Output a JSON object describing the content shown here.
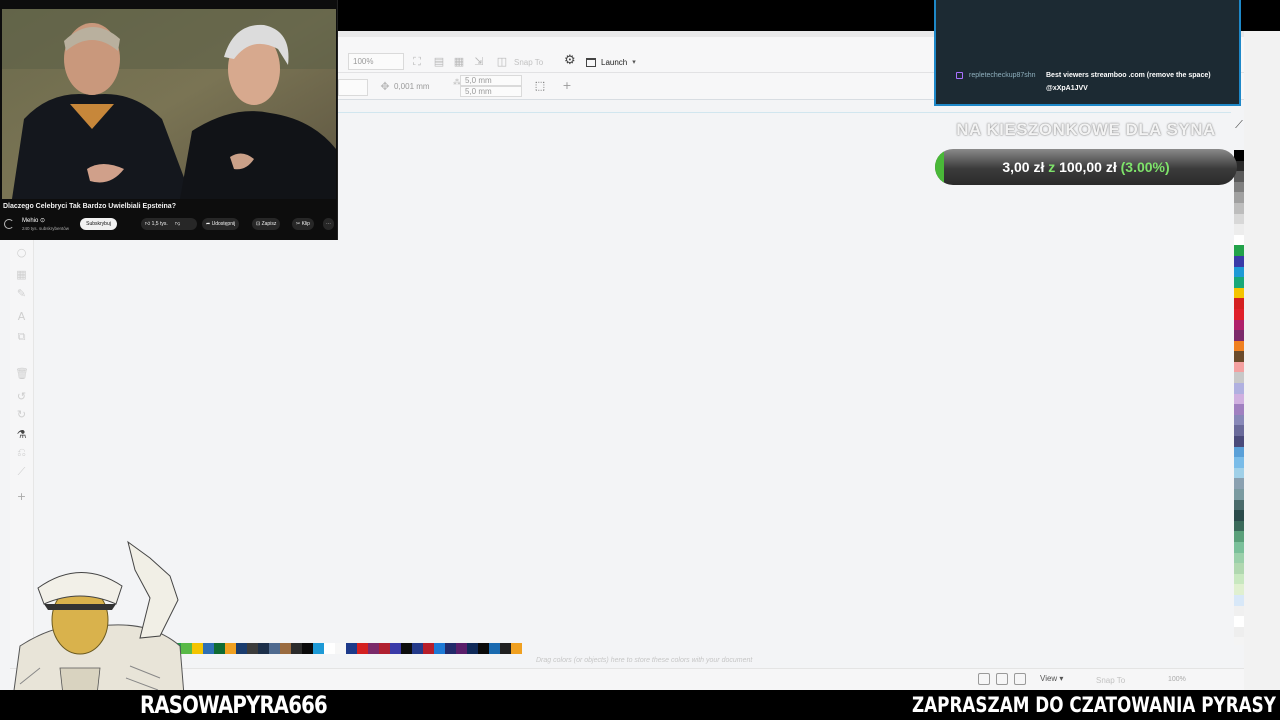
{
  "app": {
    "zoom_field": "100%",
    "nudge_value": "0,001 mm",
    "dup_x": "5,0 mm",
    "dup_y": "5,0 mm",
    "snap_to": "Snap To",
    "launch_label": "Launch",
    "palette_hint": "Drag colors (or objects) here to store these colors with your document",
    "status_view": "View",
    "status_snap": "Snap To",
    "status_zoom": "100%",
    "accent": "#1e88c8",
    "document_palette": [
      "#22a24a",
      "#58b947",
      "#f4c400",
      "#2e6fb5",
      "#0f6b33",
      "#f0a020",
      "#1a3c6e",
      "#3c3c3c",
      "#1c2f4a",
      "#4f6a8f",
      "#9a6b40",
      "#2b2b2b",
      "#0a0a0a",
      "#1e9ad6",
      "#ffffff",
      "#f7f7f7",
      "#1d3a8a",
      "#d42020",
      "#7b2a6a",
      "#b02030",
      "#3a3aa8",
      "#0d0d0d",
      "#243a8a",
      "#b81e2a",
      "#1e7ad6",
      "#222a6a",
      "#5a1e6a",
      "#102a5a",
      "#0a0a0a",
      "#1a6ab0",
      "#202020",
      "#f0a020"
    ],
    "right_palette": [
      "#000000",
      "#2b2b2b",
      "#5a5a5a",
      "#7f7f7f",
      "#a0a0a0",
      "#bdbdbd",
      "#d8d8d8",
      "#ededed",
      "#ffffff",
      "#22a24a",
      "#3a3aa8",
      "#1e9ad6",
      "#18a878",
      "#f4c400",
      "#d42020",
      "#e0202a",
      "#b0206a",
      "#7b2a6a",
      "#f08020",
      "#6a4a2a",
      "#f4a0a0",
      "#c8c8c8",
      "#b0b0e0",
      "#d0b0e0",
      "#a080c0",
      "#8888b8",
      "#6a6a9a",
      "#4a4a7a",
      "#5aa0d8",
      "#7abce8",
      "#a0d0e8",
      "#8aa0b0",
      "#7a9aa0",
      "#4a6a6a",
      "#2a4a4a",
      "#3a6a5a",
      "#5aa07a",
      "#7ac09a",
      "#9ad0aa",
      "#b0d8b0",
      "#c8e8c0",
      "#e0f0d0",
      "#d8e8f8",
      "#f0f0f0",
      "#ffffff",
      "#eeeeee"
    ]
  },
  "video": {
    "title": "Dlaczego Celebryci Tak Bardzo Uwielbiali Epsteina?",
    "channel": "Mehio ⊙",
    "subscribers": "240 tys. subskrybentów",
    "subscribe_label": "Subskrybuj",
    "likes": "1,5 tys.",
    "share_label": "Udostępnij",
    "save_label": "Zapisz",
    "clip_label": "Klip",
    "more_label": "⋯"
  },
  "chat": {
    "user": "repletecheckup87shn",
    "message": "Best viewers streamboo .com (remove the space)",
    "message2": "@xXpA1JVV"
  },
  "goal": {
    "title": "NA KIESZONKOWE DLA SYNA",
    "current": "3,00 zł",
    "of": "z",
    "target": "100,00 zł",
    "percent_text": "(3.00%)",
    "progress": 0.03
  },
  "overlay": {
    "streamer_name": "RASOWAPYRA666",
    "ticker": "ZAPRASZAM DO CZATOWANIA PYRASY"
  }
}
